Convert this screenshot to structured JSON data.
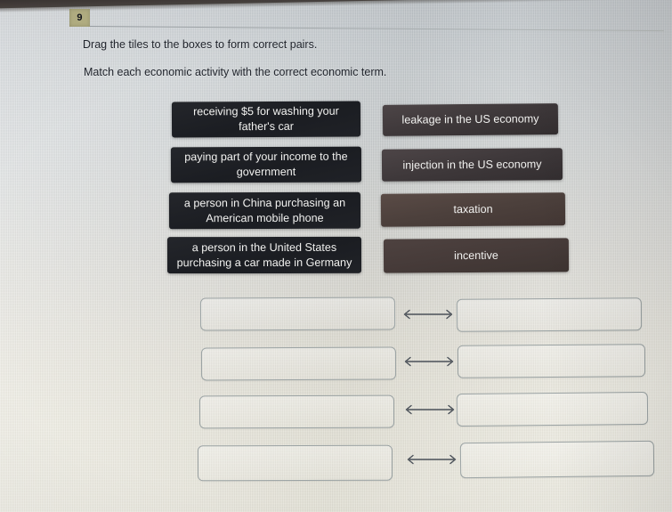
{
  "header": {
    "question_number": "9",
    "instruction_primary": "Drag the tiles to the boxes to form correct pairs.",
    "instruction_secondary": "Match each economic activity with the correct economic term."
  },
  "tiles": {
    "activities": [
      {
        "id": "activity-1",
        "label": "receiving $5 for washing your father's car"
      },
      {
        "id": "activity-2",
        "label": "paying part of your income to the government"
      },
      {
        "id": "activity-3",
        "label": "a person in China purchasing an American mobile phone"
      },
      {
        "id": "activity-4",
        "label": "a person in the United States purchasing a car made in Germany"
      }
    ],
    "terms": [
      {
        "id": "term-1",
        "label": "leakage in the US economy"
      },
      {
        "id": "term-2",
        "label": "injection in the US economy"
      },
      {
        "id": "term-3",
        "label": "taxation"
      },
      {
        "id": "term-4",
        "label": "incentive"
      }
    ]
  },
  "drop_zones": {
    "rows": [
      {
        "left_value": "",
        "right_value": "",
        "connector": "double-arrow"
      },
      {
        "left_value": "",
        "right_value": "",
        "connector": "double-arrow"
      },
      {
        "left_value": "",
        "right_value": "",
        "connector": "double-arrow"
      },
      {
        "left_value": "",
        "right_value": "",
        "connector": "double-arrow"
      }
    ]
  },
  "colors": {
    "tile_dark": "#1f2126",
    "tile_gray": "#3e383a",
    "tile_brown": "#4c403c",
    "badge_background": "#b5b184",
    "text_primary": "#20242c",
    "drop_border": "#9ba3a4",
    "arrow": "#4a5058"
  }
}
